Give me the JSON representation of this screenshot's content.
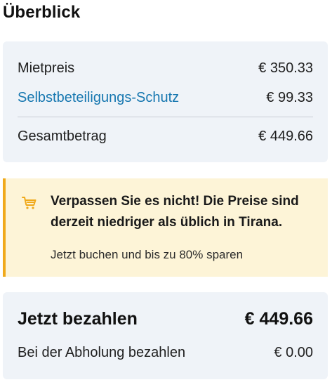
{
  "overview": {
    "title": "Überblick"
  },
  "price_summary": {
    "rent_label": "Mietpreis",
    "rent_value": "€ 350.33",
    "protection_label": "Selbstbeteiligungs-Schutz",
    "protection_value": "€ 99.33",
    "total_label": "Gesamtbetrag",
    "total_value": "€ 449.66"
  },
  "promo": {
    "icon": "shopping-cart-icon",
    "headline": "Verpassen Sie es nicht! Die Preise sind derzeit niedriger als üblich in Tirana.",
    "subtext": "Jetzt buchen und bis zu 80% sparen",
    "accent_color": "#f0a91a",
    "background_color": "#fdf4d7"
  },
  "payment": {
    "pay_now_label": "Jetzt bezahlen",
    "pay_now_value": "€ 449.66",
    "pay_later_label": "Bei der Abholung bezahlen",
    "pay_later_value": "€ 0.00"
  },
  "colors": {
    "link": "#1677b0",
    "card_background": "#eff3f8"
  }
}
